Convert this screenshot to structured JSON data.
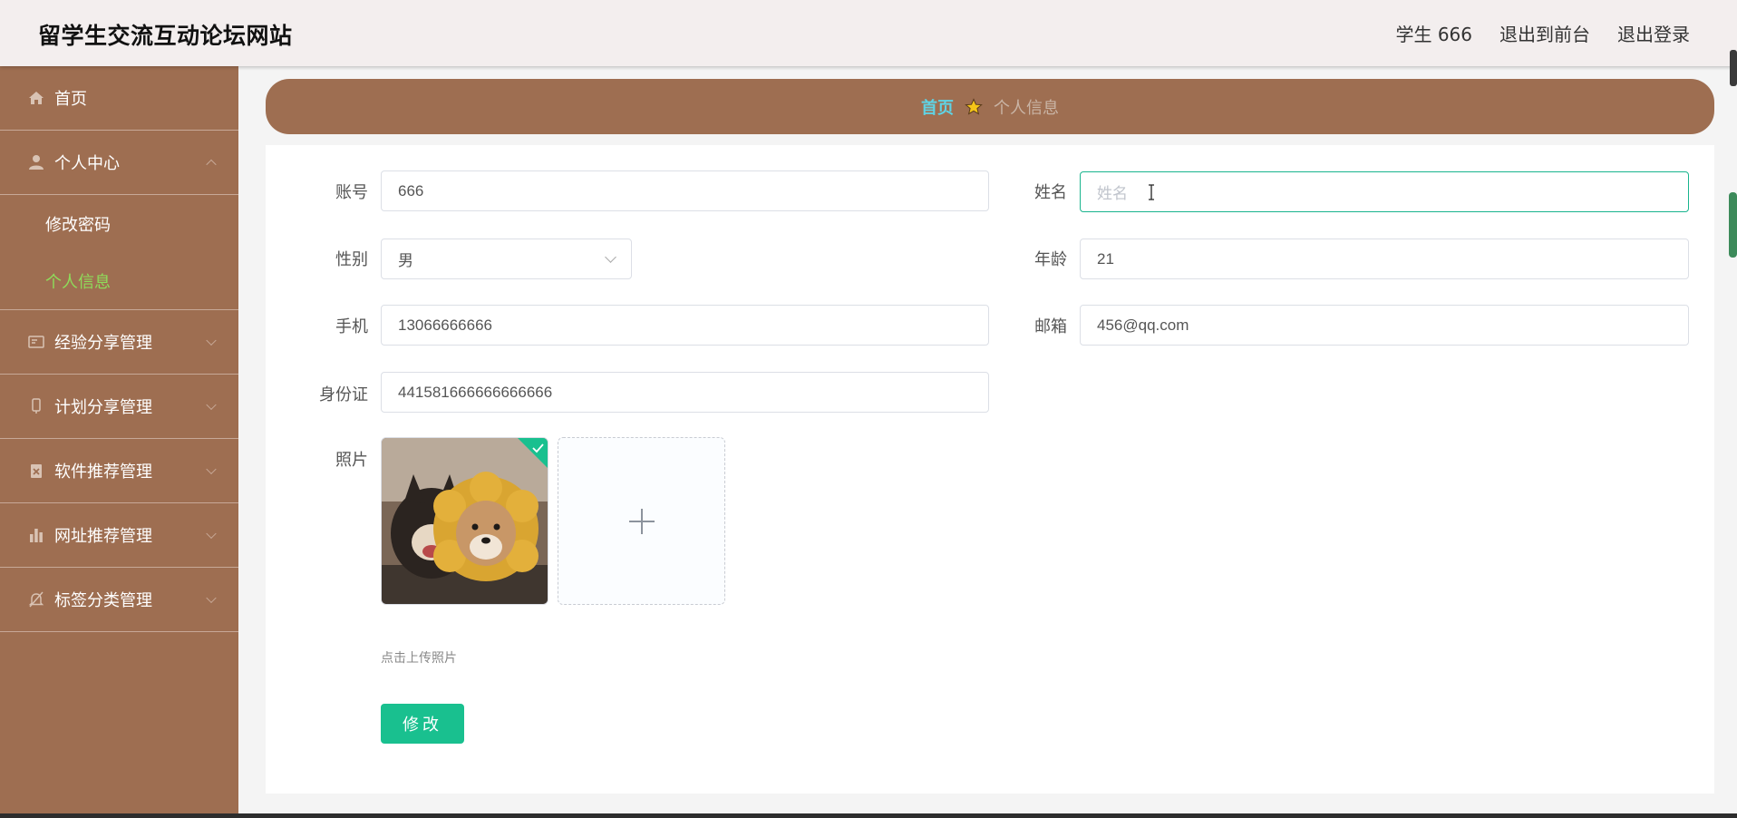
{
  "header": {
    "site_title": "留学生交流互动论坛网站",
    "user_label": "学生 666",
    "to_front": "退出到前台",
    "logout": "退出登录"
  },
  "sidebar": {
    "items": [
      {
        "label": "首页",
        "icon": "home-icon"
      },
      {
        "label": "个人中心",
        "icon": "user-icon",
        "expanded": true,
        "children": [
          {
            "label": "修改密码"
          },
          {
            "label": "个人信息",
            "active": true
          }
        ]
      },
      {
        "label": "经验分享管理",
        "icon": "card-icon"
      },
      {
        "label": "计划分享管理",
        "icon": "phone-icon"
      },
      {
        "label": "软件推荐管理",
        "icon": "clipboard-x-icon"
      },
      {
        "label": "网址推荐管理",
        "icon": "bar-chart-icon"
      },
      {
        "label": "标签分类管理",
        "icon": "bell-off-icon"
      }
    ]
  },
  "breadcrumb": {
    "home": "首页",
    "current": "个人信息"
  },
  "form": {
    "account_label": "账号",
    "account_value": "666",
    "name_label": "姓名",
    "name_placeholder": "姓名",
    "gender_label": "性别",
    "gender_value": "男",
    "age_label": "年龄",
    "age_value": "21",
    "phone_label": "手机",
    "phone_value": "13066666666",
    "email_label": "邮箱",
    "email_value": "456@qq.com",
    "id_label": "身份证",
    "id_value": "441581666666666666",
    "photo_label": "照片",
    "upload_hint": "点击上传照片",
    "submit": "修改"
  },
  "colors": {
    "sidebar_bg": "#9e6e51",
    "accent_green": "#19c08f",
    "active_submenu": "#8edc5a",
    "breadcrumb_home": "#5fd3e4"
  }
}
